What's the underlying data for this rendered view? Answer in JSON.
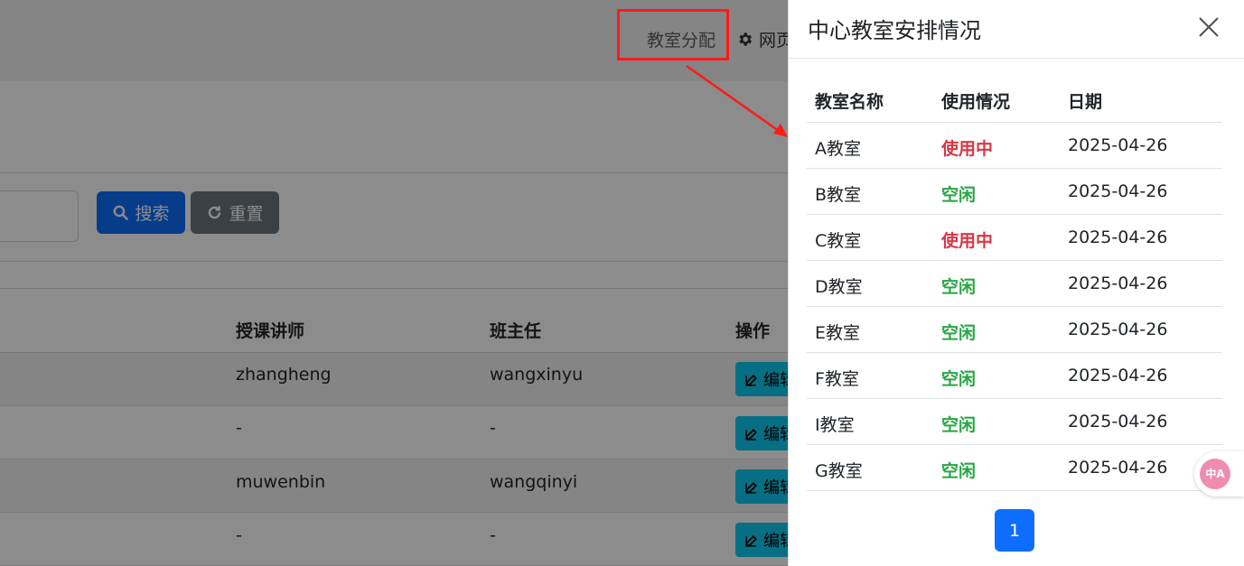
{
  "header": {
    "assign_link": "教室分配",
    "settings_link": "网页"
  },
  "toolbar": {
    "search_label": "搜索",
    "reset_label": "重置"
  },
  "table": {
    "columns": [
      "授课讲师",
      "班主任",
      "操作"
    ],
    "rows": [
      {
        "teacher": "zhangheng",
        "head_teacher": "wangxinyu",
        "action": "编辑"
      },
      {
        "teacher": "-",
        "head_teacher": "-",
        "action": "编辑"
      },
      {
        "teacher": "muwenbin",
        "head_teacher": "wangqinyi",
        "action": "编辑"
      },
      {
        "teacher": "-",
        "head_teacher": "-",
        "action": "编辑"
      }
    ]
  },
  "panel": {
    "title": "中心教室安排情况",
    "columns": [
      "教室名称",
      "使用情况",
      "日期"
    ],
    "rows": [
      {
        "name": "A教室",
        "status": "使用中",
        "date": "2025-04-26"
      },
      {
        "name": "B教室",
        "status": "空闲",
        "date": "2025-04-26"
      },
      {
        "name": "C教室",
        "status": "使用中",
        "date": "2025-04-26"
      },
      {
        "name": "D教室",
        "status": "空闲",
        "date": "2025-04-26"
      },
      {
        "name": "E教室",
        "status": "空闲",
        "date": "2025-04-26"
      },
      {
        "name": "F教室",
        "status": "空闲",
        "date": "2025-04-26"
      },
      {
        "name": "I教室",
        "status": "空闲",
        "date": "2025-04-26"
      },
      {
        "name": "G教室",
        "status": "空闲",
        "date": "2025-04-26"
      }
    ],
    "page": "1"
  },
  "translate_widget": {
    "label": "中A"
  },
  "colors": {
    "busy": "#dc3545",
    "free": "#28a745",
    "primary": "#0d6efd",
    "highlight": "#ff1a1a"
  }
}
